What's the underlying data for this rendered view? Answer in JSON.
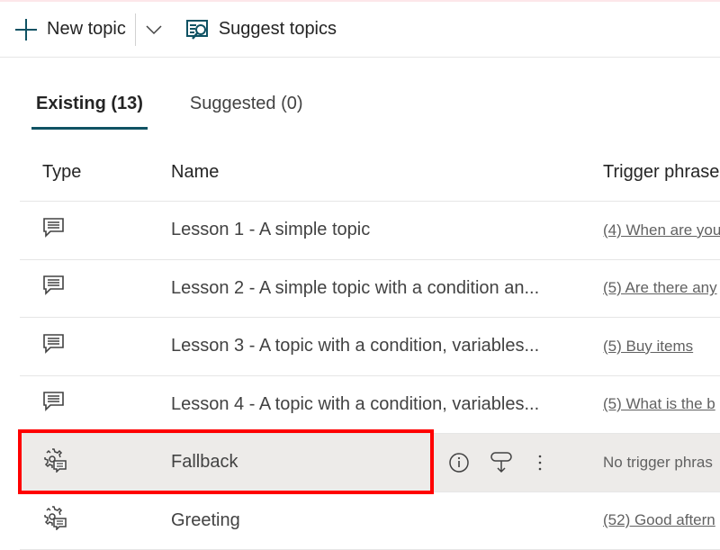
{
  "toolbar": {
    "new_topic": "New topic",
    "suggest_topics": "Suggest topics"
  },
  "tabs": [
    {
      "label": "Existing (13)",
      "active": true
    },
    {
      "label": "Suggested (0)",
      "active": false
    }
  ],
  "columns": {
    "type": "Type",
    "name": "Name",
    "trigger": "Trigger phrase"
  },
  "rows": [
    {
      "icon": "chat-icon",
      "name": "Lesson 1 - A simple topic",
      "trigger": "(4) When are you"
    },
    {
      "icon": "chat-icon",
      "name": "Lesson 2 - A simple topic with a condition an...",
      "trigger": "(5) Are there any"
    },
    {
      "icon": "chat-icon",
      "name": "Lesson 3 - A topic with a condition, variables...",
      "trigger": "(5) Buy items"
    },
    {
      "icon": "chat-icon",
      "name": "Lesson 4 - A topic with a condition, variables...",
      "trigger": "(5) What is the b"
    },
    {
      "icon": "system-gear-chat-icon",
      "name": "Fallback",
      "trigger": "No trigger phras",
      "selected": true
    },
    {
      "icon": "system-gear-chat-icon",
      "name": "Greeting",
      "trigger": "(52) Good aftern"
    }
  ],
  "colors": {
    "accent": "#0f5263",
    "highlight": "#ff0000",
    "selected_row": "#edebe9"
  }
}
